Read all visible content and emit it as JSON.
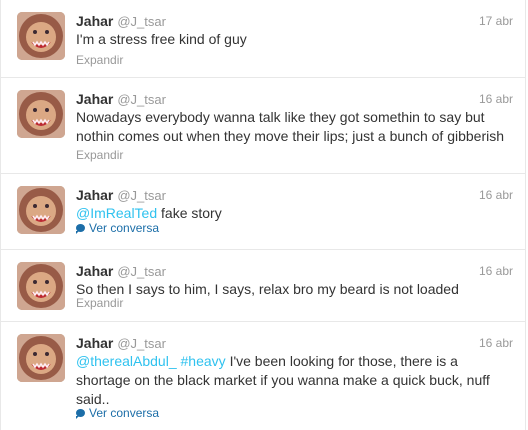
{
  "tweets": [
    {
      "name": "Jahar",
      "handle": "@J_tsar",
      "time": "17 abr",
      "text": "I'm a stress free kind of guy",
      "action": "Expandir"
    },
    {
      "name": "Jahar",
      "handle": "@J_tsar",
      "time": "16 abr",
      "text": "Nowadays everybody wanna talk like they got somethin to say but nothin comes out when they move their lips; just a bunch of gibberish",
      "action": "Expandir"
    },
    {
      "name": "Jahar",
      "handle": "@J_tsar",
      "time": "16 abr",
      "mention": "@ImRealTed",
      "text": "fake story",
      "action": "Ver conversa"
    },
    {
      "name": "Jahar",
      "handle": "@J_tsar",
      "time": "16 abr",
      "text": "So then I says to him, I says, relax bro my beard is not loaded",
      "action": "Expandir"
    },
    {
      "name": "Jahar",
      "handle": "@J_tsar",
      "time": "16 abr",
      "mention": "@therealAbdul_",
      "hashtag": "#heavy",
      "text": "I've been looking for those, there is a shortage on the black market if you wanna make a quick buck, nuff said..",
      "action": "Ver conversa"
    }
  ],
  "icons": {
    "avatar": "lion-avatar-icon",
    "conversation": "speech-bubble-icon"
  },
  "colors": {
    "link": "#2fc2ef",
    "conversation": "#1c6ea8",
    "meta": "#999999",
    "text": "#333333"
  }
}
